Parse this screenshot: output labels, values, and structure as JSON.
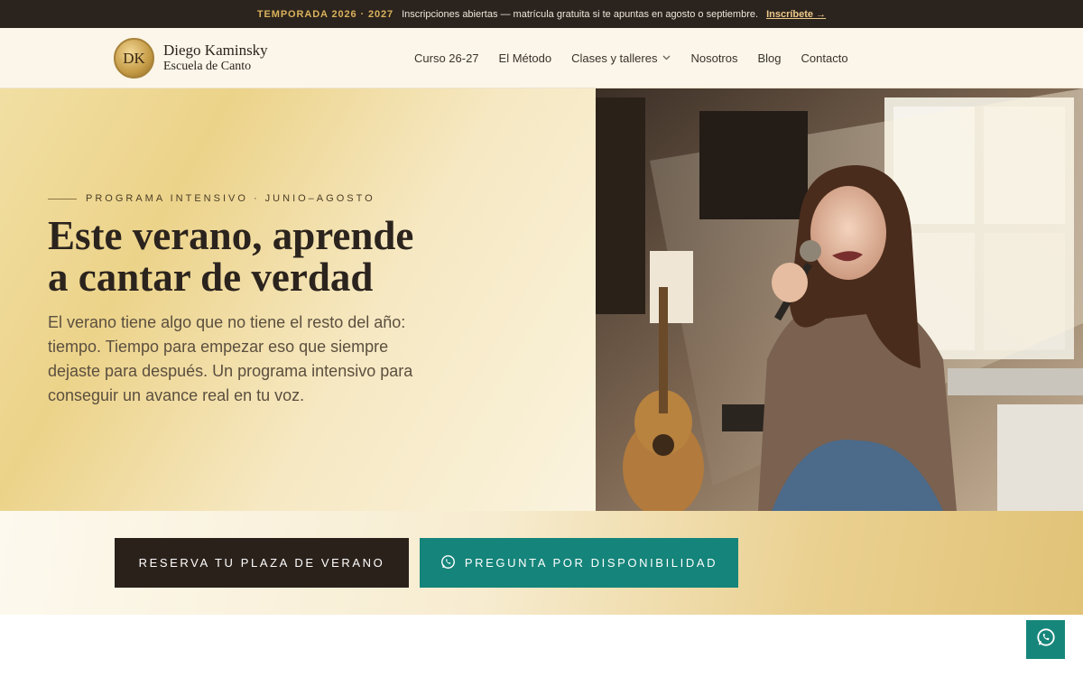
{
  "topbar": {
    "season": "TEMPORADA 2026 · 2027",
    "message": "Inscripciones abiertas — matrícula gratuita si te apuntas en agosto o septiembre.",
    "cta": "Inscríbete →"
  },
  "header": {
    "logo": {
      "initials": "DK",
      "name": "Diego Kaminsky",
      "subtitle": "Escuela de Canto"
    },
    "nav": [
      {
        "label": "Curso 26-27"
      },
      {
        "label": "El Método"
      },
      {
        "label": "Clases y talleres",
        "dropdown": true
      },
      {
        "label": "Nosotros"
      },
      {
        "label": "Blog"
      },
      {
        "label": "Contacto"
      }
    ]
  },
  "hero": {
    "eyebrow": "PROGRAMA INTENSIVO · JUNIO–AGOSTO",
    "title_line1": "Este verano, aprende",
    "title_line2": "a cantar de verdad",
    "body": "El verano tiene algo que no tiene el resto del año: tiempo. Tiempo para empezar eso que siempre dejaste para después. Un programa intensivo para conseguir un avance real en tu voz."
  },
  "cta": {
    "primary": "RESERVA TU PLAZA DE VERANO",
    "secondary": "PREGUNTA POR DISPONIBILIDAD"
  },
  "icons": {
    "whatsapp": "whatsapp-icon",
    "chevron": "chevron-down-icon"
  },
  "colors": {
    "dark": "#2b231d",
    "gold": "#d9b25c",
    "teal": "#15847a"
  }
}
